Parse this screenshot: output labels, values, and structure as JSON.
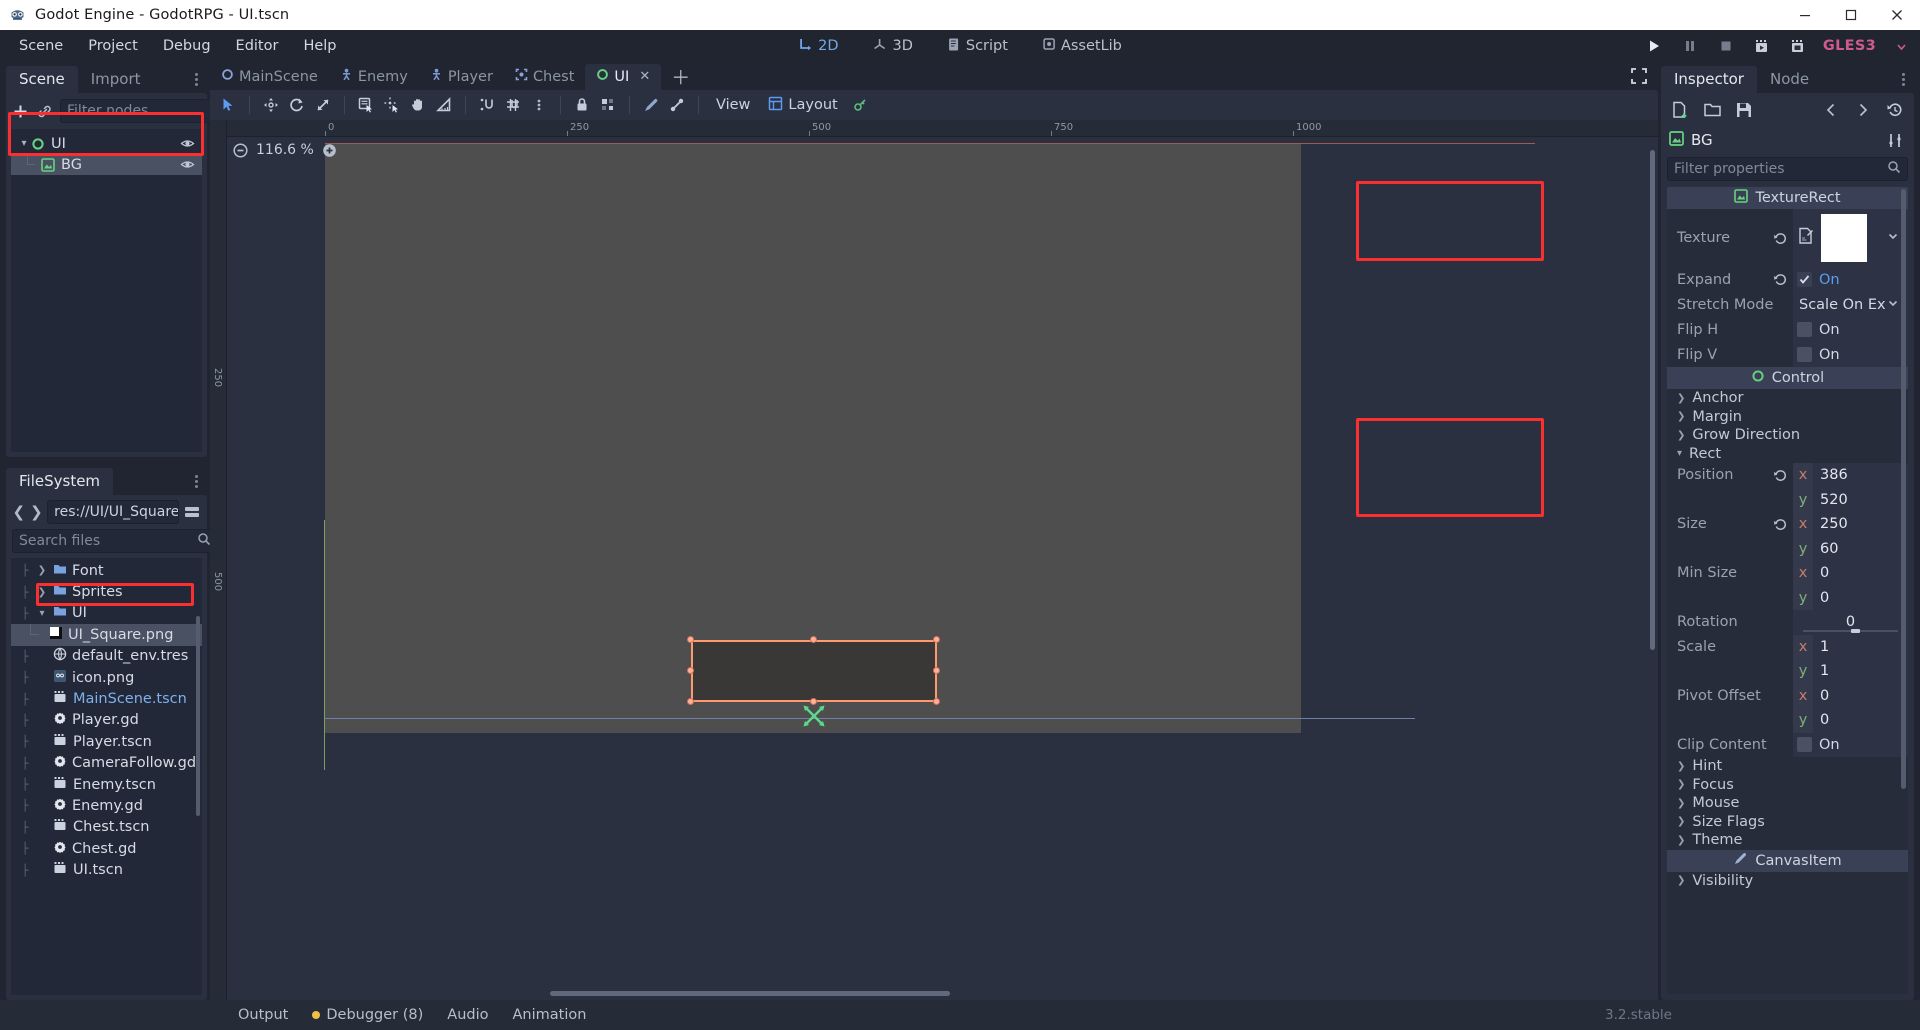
{
  "window": {
    "title": "Godot Engine - GodotRPG - UI.tscn",
    "app_icon": "godot-robot-icon",
    "minimize": "minimize-icon",
    "maximize": "maximize-icon",
    "close": "close-icon"
  },
  "menubar": {
    "items": [
      "Scene",
      "Project",
      "Debug",
      "Editor",
      "Help"
    ],
    "center_tabs": [
      {
        "label": "2D",
        "icon": "2d-icon",
        "active": true
      },
      {
        "label": "3D",
        "icon": "3d-icon",
        "active": false
      },
      {
        "label": "Script",
        "icon": "script-icon",
        "active": false
      },
      {
        "label": "AssetLib",
        "icon": "assetlib-icon",
        "active": false
      }
    ],
    "run_controls": [
      {
        "name": "play-button",
        "icon": "play-icon"
      },
      {
        "name": "pause-button",
        "icon": "pause-icon"
      },
      {
        "name": "stop-button",
        "icon": "stop-icon"
      },
      {
        "name": "play-scene-button",
        "icon": "play-scene-icon"
      },
      {
        "name": "play-custom-scene-button",
        "icon": "play-custom-icon"
      }
    ],
    "renderer": "GLES3"
  },
  "scene_panel": {
    "tabs": [
      {
        "label": "Scene",
        "active": true
      },
      {
        "label": "Import",
        "active": false
      }
    ],
    "add_node_icon": "plus-icon",
    "instance_icon": "link-icon",
    "filter_placeholder": "Filter nodes",
    "filter_value": "",
    "search_icon": "search-icon",
    "script_icon": "create-script-icon",
    "menu_icon": "kebab-menu-icon",
    "nodes": [
      {
        "label": "UI",
        "type_icon": "control-node-icon",
        "depth": 0,
        "expanded": true,
        "selected": false,
        "visibility_icon": "eye-icon"
      },
      {
        "label": "BG",
        "type_icon": "texturerect-node-icon",
        "depth": 1,
        "expanded": false,
        "selected": true,
        "visibility_icon": "eye-icon"
      }
    ]
  },
  "filesystem_panel": {
    "tab_label": "FileSystem",
    "menu_icon": "kebab-menu-icon",
    "back_icon": "chevron-left-icon",
    "forward_icon": "chevron-right-icon",
    "path_value": "res://UI/UI_Square.pn",
    "split_icon": "split-mode-icon",
    "search_placeholder": "Search files",
    "search_value": "",
    "search_icon": "search-icon",
    "files": [
      {
        "label": "Font",
        "icon": "folder-icon",
        "depth": 1,
        "twisty": "collapsed",
        "selected": false,
        "link": false
      },
      {
        "label": "Sprites",
        "icon": "folder-icon",
        "depth": 1,
        "twisty": "collapsed",
        "selected": false,
        "link": false
      },
      {
        "label": "UI",
        "icon": "folder-icon",
        "depth": 1,
        "twisty": "expanded",
        "selected": false,
        "link": false
      },
      {
        "label": "UI_Square.png",
        "icon": "image-file-icon",
        "depth": 2,
        "twisty": "none",
        "selected": true,
        "link": false
      },
      {
        "label": "default_env.tres",
        "icon": "environment-icon",
        "depth": 1,
        "twisty": "none",
        "selected": false,
        "link": false
      },
      {
        "label": "icon.png",
        "icon": "godot-icon-file",
        "depth": 1,
        "twisty": "none",
        "selected": false,
        "link": false
      },
      {
        "label": "MainScene.tscn",
        "icon": "scene-file-icon",
        "depth": 1,
        "twisty": "none",
        "selected": false,
        "link": true
      },
      {
        "label": "Player.gd",
        "icon": "gdscript-icon",
        "depth": 1,
        "twisty": "none",
        "selected": false,
        "link": false
      },
      {
        "label": "Player.tscn",
        "icon": "scene-file-icon",
        "depth": 1,
        "twisty": "none",
        "selected": false,
        "link": false
      },
      {
        "label": "CameraFollow.gd",
        "icon": "gdscript-icon",
        "depth": 1,
        "twisty": "none",
        "selected": false,
        "link": false
      },
      {
        "label": "Enemy.tscn",
        "icon": "scene-file-icon",
        "depth": 1,
        "twisty": "none",
        "selected": false,
        "link": false
      },
      {
        "label": "Enemy.gd",
        "icon": "gdscript-icon",
        "depth": 1,
        "twisty": "none",
        "selected": false,
        "link": false
      },
      {
        "label": "Chest.tscn",
        "icon": "scene-file-icon",
        "depth": 1,
        "twisty": "none",
        "selected": false,
        "link": false
      },
      {
        "label": "Chest.gd",
        "icon": "gdscript-icon",
        "depth": 1,
        "twisty": "none",
        "selected": false,
        "link": false
      },
      {
        "label": "UI.tscn",
        "icon": "scene-file-icon",
        "depth": 1,
        "twisty": "none",
        "selected": false,
        "link": false
      }
    ]
  },
  "editor": {
    "scene_tabs": [
      {
        "label": "MainScene",
        "icon": "node2d-icon",
        "active": false
      },
      {
        "label": "Enemy",
        "icon": "kinematicbody2d-icon",
        "active": false
      },
      {
        "label": "Player",
        "icon": "kinematicbody2d-icon",
        "active": false
      },
      {
        "label": "Chest",
        "icon": "area2d-icon",
        "active": false
      },
      {
        "label": "UI",
        "icon": "control-node-icon",
        "active": true,
        "closable": true
      }
    ],
    "add_scene_tab": "plus-icon",
    "distraction_free_icon": "expand-icon",
    "toolbar": [
      {
        "name": "select-mode-button",
        "icon": "cursor-arrow-icon",
        "active": true
      },
      {
        "name": "move-mode-button",
        "icon": "move-icon",
        "active": false
      },
      {
        "name": "rotate-mode-button",
        "icon": "rotate-icon",
        "active": false
      },
      {
        "name": "scale-mode-button",
        "icon": "scale-icon",
        "active": false
      },
      {
        "name": "list-select-button",
        "icon": "list-select-icon",
        "active": false
      },
      {
        "name": "pivot-mode-button",
        "icon": "pivot-icon",
        "active": false
      },
      {
        "name": "pan-mode-button",
        "icon": "hand-icon",
        "active": false
      },
      {
        "name": "ruler-mode-button",
        "icon": "ruler-icon",
        "active": false
      },
      {
        "name": "smart-snap-button",
        "icon": "smart-snap-icon",
        "active": false
      },
      {
        "name": "grid-snap-button",
        "icon": "grid-snap-icon",
        "active": false
      },
      {
        "name": "snap-options-button",
        "icon": "kebab-menu-icon",
        "active": false
      },
      {
        "name": "lock-button",
        "icon": "lock-icon",
        "active": false
      },
      {
        "name": "group-button",
        "icon": "group-icon",
        "active": false
      },
      {
        "name": "skeleton-button",
        "icon": "bone-icon",
        "active": false
      }
    ],
    "view_menu": "View",
    "layout_menu": "Layout",
    "layout_icon": "layout-icon",
    "anim_key_icon": "animation-key-icon",
    "paint_icon": "paint-icon",
    "zoom_out_icon": "zoom-out-icon",
    "zoom_in_icon": "zoom-in-icon",
    "zoom_value": "116.6 %",
    "ruler_ticks_h": [
      "0",
      "250",
      "500",
      "750",
      "1000"
    ],
    "ruler_ticks_v": [
      "250",
      "500"
    ]
  },
  "inspector": {
    "tabs": [
      {
        "label": "Inspector",
        "active": true
      },
      {
        "label": "Node",
        "active": false
      }
    ],
    "menu_icon": "kebab-menu-icon",
    "toolbar": [
      {
        "name": "new-resource-button",
        "icon": "new-resource-icon"
      },
      {
        "name": "load-resource-button",
        "icon": "folder-open-icon"
      },
      {
        "name": "save-resource-button",
        "icon": "save-icon"
      },
      {
        "name": "history-back-button",
        "icon": "chevron-left-icon"
      },
      {
        "name": "history-forward-button",
        "icon": "chevron-right-icon"
      },
      {
        "name": "history-button",
        "icon": "history-icon"
      }
    ],
    "selected_node": "BG",
    "selected_node_icon": "texturerect-node-icon",
    "object_tools_icon": "object-tools-icon",
    "filter_placeholder": "Filter properties",
    "filter_value": "",
    "search_icon": "search-icon",
    "sections": [
      {
        "name": "TextureRect",
        "icon": "texturerect-node-icon",
        "properties": [
          {
            "label": "Texture",
            "kind": "texture_preview",
            "value": "",
            "revert": true,
            "swatch_color": "#ffffff",
            "dropdown": true,
            "highlighted": true
          },
          {
            "label": "Expand",
            "kind": "checkbox",
            "value": "On",
            "checked": true,
            "revert": true,
            "highlighted": true
          },
          {
            "label": "Stretch Mode",
            "kind": "enum",
            "value": "Scale On Ex",
            "dropdown": true
          },
          {
            "label": "Flip H",
            "kind": "checkbox",
            "value": "On",
            "checked": false
          },
          {
            "label": "Flip V",
            "kind": "checkbox",
            "value": "On",
            "checked": false
          }
        ]
      },
      {
        "name": "Control",
        "icon": "control-node-icon",
        "properties": [
          {
            "label": "Anchor",
            "kind": "group",
            "expanded": false
          },
          {
            "label": "Margin",
            "kind": "group",
            "expanded": false
          },
          {
            "label": "Grow Direction",
            "kind": "group",
            "expanded": false
          },
          {
            "label": "Rect",
            "kind": "group",
            "expanded": true
          },
          {
            "label": "Position",
            "kind": "vector2",
            "x": "386",
            "y": "520",
            "revert": true,
            "highlighted": true
          },
          {
            "label": "Size",
            "kind": "vector2",
            "x": "250",
            "y": "60",
            "revert": true,
            "highlighted": true
          },
          {
            "label": "Min Size",
            "kind": "vector2",
            "x": "0",
            "y": "0",
            "revert": false
          },
          {
            "label": "Rotation",
            "kind": "slider",
            "value": "0"
          },
          {
            "label": "Scale",
            "kind": "vector2",
            "x": "1",
            "y": "1",
            "revert": false
          },
          {
            "label": "Pivot Offset",
            "kind": "vector2",
            "x": "0",
            "y": "0",
            "revert": false
          },
          {
            "label": "Clip Content",
            "kind": "checkbox",
            "value": "On",
            "checked": false
          },
          {
            "label": "Hint",
            "kind": "group",
            "expanded": false
          },
          {
            "label": "Focus",
            "kind": "group",
            "expanded": false
          },
          {
            "label": "Mouse",
            "kind": "group",
            "expanded": false
          },
          {
            "label": "Size Flags",
            "kind": "group",
            "expanded": false
          },
          {
            "label": "Theme",
            "kind": "group",
            "expanded": false
          }
        ]
      },
      {
        "name": "CanvasItem",
        "icon": "canvasitem-icon",
        "properties": [
          {
            "label": "Visibility",
            "kind": "group",
            "expanded": false
          }
        ]
      }
    ]
  },
  "bottom_panel": {
    "tabs": [
      {
        "label": "Output",
        "badge": false
      },
      {
        "label": "Debugger (8)",
        "badge": true,
        "badge_color": "#f0c043"
      },
      {
        "label": "Audio",
        "badge": false
      },
      {
        "label": "Animation",
        "badge": false
      }
    ],
    "version": "3.2.stable"
  },
  "colors": {
    "accent_blue": "#72a6e8",
    "selection_orange": "#ff9a6e",
    "highlight_red": "#fa2f2f",
    "renderer_pink": "#cf5a8e",
    "panel_bg": "#2a3040",
    "window_bg": "#202531",
    "field_bg": "#232838"
  }
}
